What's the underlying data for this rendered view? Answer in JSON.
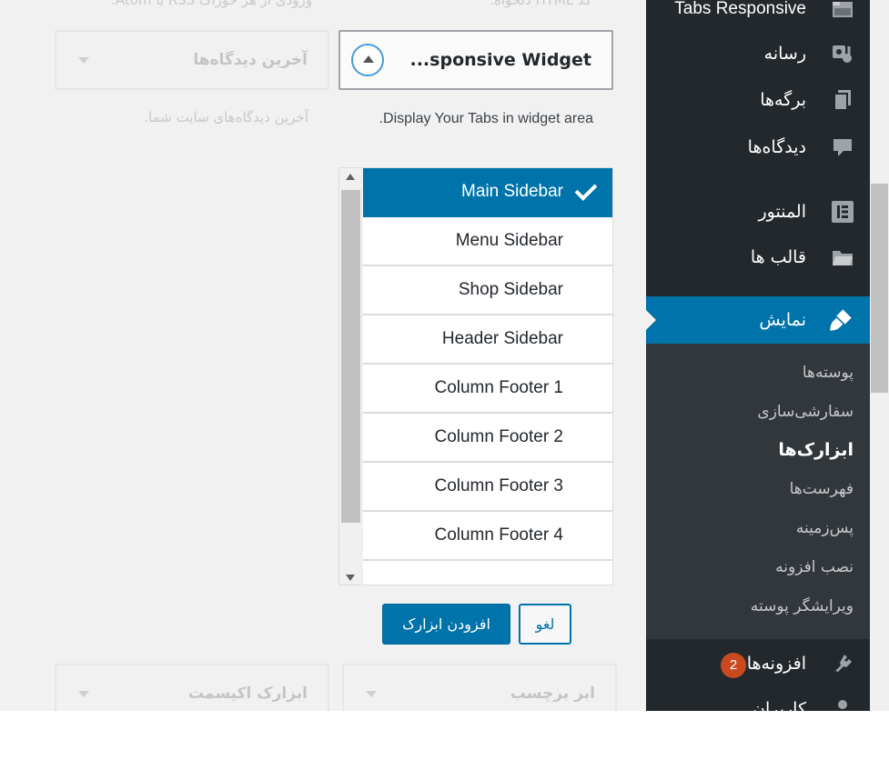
{
  "top_texts": {
    "right_col_desc": "کد HTML دلخواه.",
    "left_col_desc": "ورودی از هر خوراک RSS یا Atom."
  },
  "left_widgets": {
    "recent_comments_title": "آخرین دیدگاه‌ها",
    "recent_comments_desc": "آخرین دیدگاه‌های سایت شما.",
    "tag_cloud_title": "ابر برچسب",
    "excerpt_widget_title": "ابزارک اکیسمت"
  },
  "active_widget": {
    "title": "Tabs Responsive Widget",
    "title_display": "...sponsive Widget",
    "description": "Display Your Tabs in widget area."
  },
  "sidebar_chooser": {
    "items": [
      {
        "label": "Main Sidebar",
        "selected": true
      },
      {
        "label": "Menu Sidebar"
      },
      {
        "label": "Shop Sidebar"
      },
      {
        "label": "Header Sidebar"
      },
      {
        "label": "Column Footer 1"
      },
      {
        "label": "Column Footer 2"
      },
      {
        "label": "Column Footer 3"
      },
      {
        "label": "Column Footer 4"
      }
    ]
  },
  "actions": {
    "add_label": "افزودن ابزارک",
    "cancel_label": "لغو"
  },
  "admin_menu": {
    "items": [
      {
        "label": "Tabs Responsive",
        "icon": "tabs-icon"
      },
      {
        "label": "رسانه",
        "icon": "media-icon"
      },
      {
        "label": "برگه‌ها",
        "icon": "pages-icon"
      },
      {
        "label": "دیدگاه‌ها",
        "icon": "comments-icon"
      },
      {
        "label": "المنتور",
        "icon": "elementor-icon"
      },
      {
        "label": "قالب ها",
        "icon": "folder-icon"
      },
      {
        "label": "نمایش",
        "icon": "brush-icon",
        "current": true
      },
      {
        "label": "افزونه‌ها",
        "icon": "plugin-icon",
        "badge": "2"
      },
      {
        "label": "کاربران",
        "icon": "user-icon"
      }
    ],
    "submenu": [
      {
        "label": "پوسته‌ها"
      },
      {
        "label": "سفارشی‌سازی"
      },
      {
        "label": "ابزارک‌ها",
        "active": true
      },
      {
        "label": "فهرست‌ها"
      },
      {
        "label": "پس‌زمینه"
      },
      {
        "label": "نصب افزونه"
      },
      {
        "label": "ویرایشگر پوسته"
      }
    ]
  },
  "colors": {
    "admin_bg": "#23282d",
    "submenu_bg": "#32373c",
    "accent": "#0073aa",
    "badge": "#ca4a1f"
  }
}
